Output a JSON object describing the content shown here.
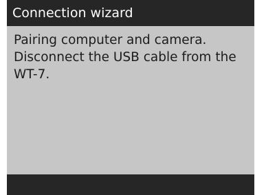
{
  "window": {
    "title": "Connection wizard"
  },
  "message": {
    "lines": [
      "Pairing computer and camera.",
      "Disconnect the USB cable from the",
      "WT-7."
    ]
  },
  "colors": {
    "title_bar": "#262626",
    "title_text": "#ffffff",
    "body_background": "#c6c6c6",
    "body_text": "#1c1c1c",
    "footer_bar": "#262626"
  }
}
